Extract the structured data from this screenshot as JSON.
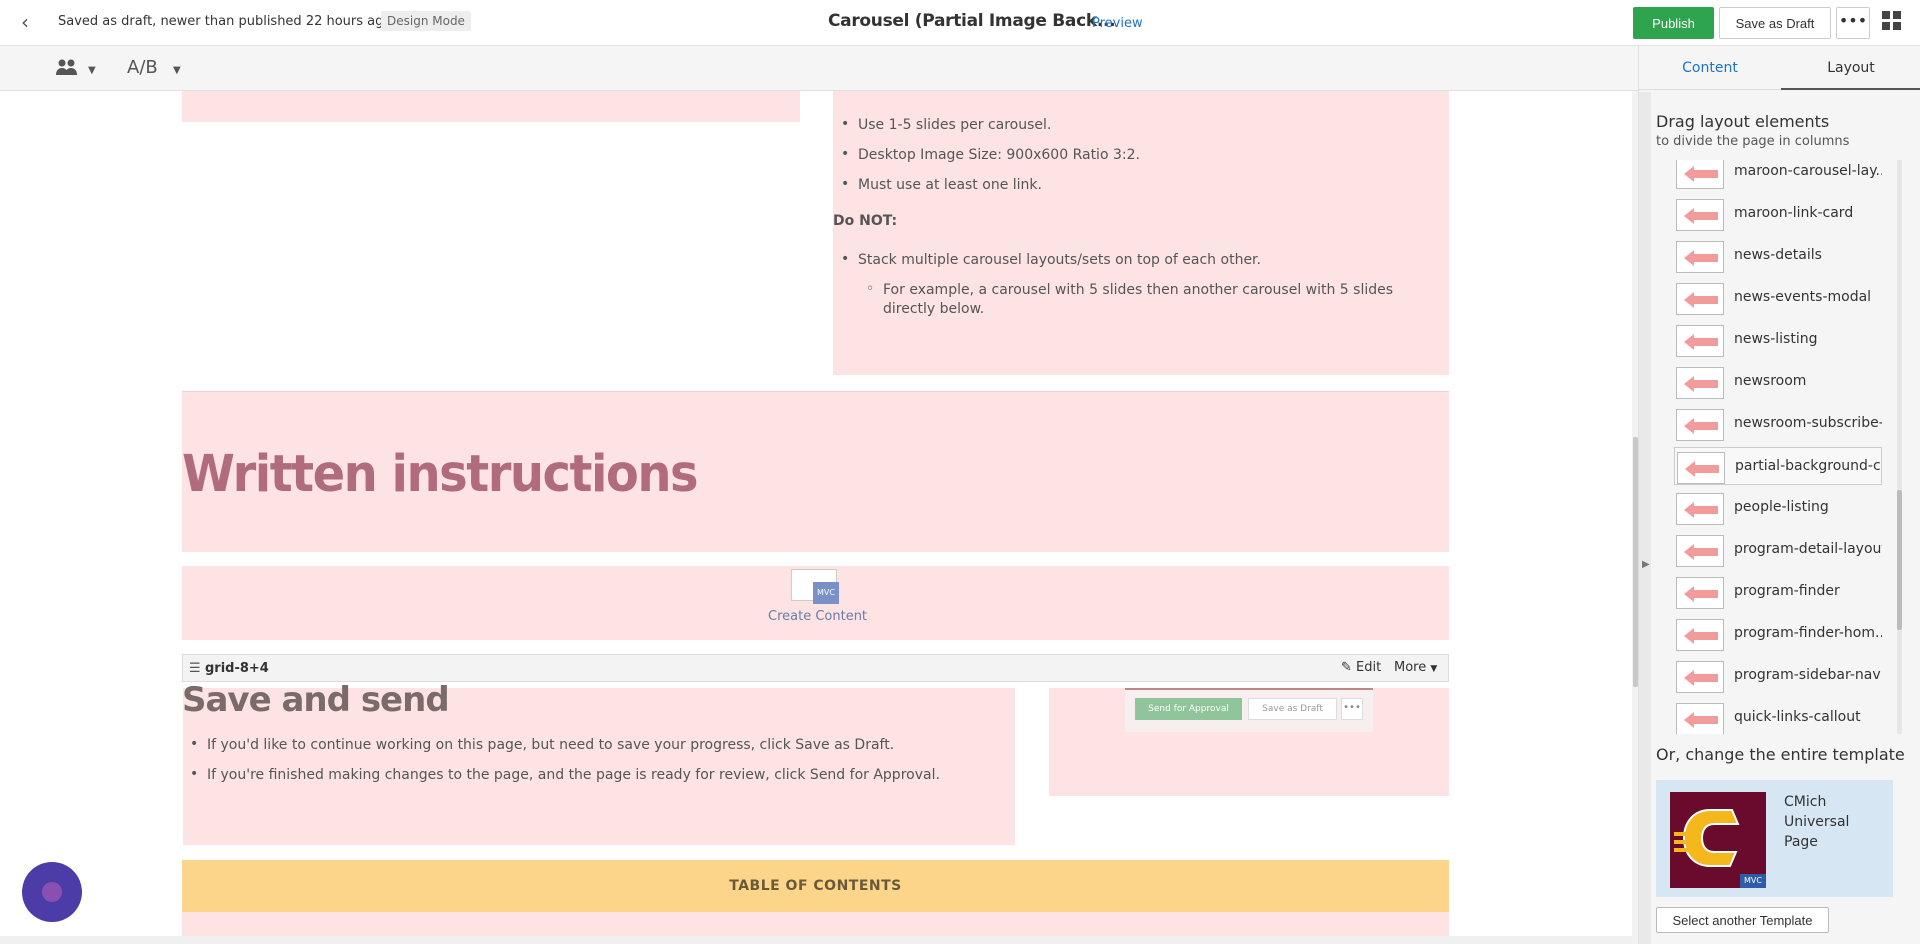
{
  "topbar": {
    "draft_status": "Saved as draft, newer than published 22 hours ago",
    "design_mode": "Design Mode",
    "page_title": "Carousel (Partial Image Back...",
    "preview": "Preview",
    "publish": "Publish",
    "save_as_draft": "Save as Draft",
    "more": "•••"
  },
  "toolbar": {
    "ab": "A/B"
  },
  "canvas": {
    "bullets_top": [
      "Use 1-5 slides per carousel.",
      "Desktop Image Size: 900x600 Ratio  3:2.",
      "Must use at least one link."
    ],
    "do_not": "Do NOT:",
    "bullets_donot": [
      "Stack multiple carousel layouts/sets on top of each other."
    ],
    "sub_bullets_donot": [
      "For example, a carousel with 5 slides then another carousel with 5 slides directly below."
    ],
    "written_heading": "Written instructions",
    "mvc_badge": "MVC",
    "create_content": "Create Content",
    "grid_label": "grid-8+4",
    "edit": "Edit",
    "more": "More",
    "save_heading": "Save and send",
    "bullets_save": [
      "If you'd like to continue working on this page, but need to save your progress, click Save as Draft.",
      "If you're finished making changes to the page, and the page is ready for review, click Send for Approval."
    ],
    "mini_send_for_approval": "Send for Approval",
    "mini_save_as_draft": "Save as Draft",
    "mini_more": "•••",
    "toc": "TABLE OF CONTENTS"
  },
  "sidebar": {
    "tabs": [
      "Content",
      "Layout"
    ],
    "drag_title": "Drag layout elements",
    "drag_sub": "to divide the page in columns",
    "layouts": [
      "maroon-carousel-lay...",
      "maroon-link-card",
      "news-details",
      "news-events-modal",
      "news-listing",
      "newsroom",
      "newsroom-subscribe-...",
      "partial-background-c...",
      "people-listing",
      "program-detail-layout",
      "program-finder",
      "program-finder-hom...",
      "program-sidebar-nav",
      "quick-links-callout"
    ],
    "change_template": "Or, change the entire template",
    "template_name": "CMich Universal Page",
    "template_mvc": "MVC",
    "select_template": "Select another Template"
  },
  "colors": {
    "publish": "#2ea44f",
    "link": "#1a73c7",
    "pink_block": "#fde3e3",
    "toc": "#fdd58a",
    "heading_written": "#b06b7d"
  }
}
